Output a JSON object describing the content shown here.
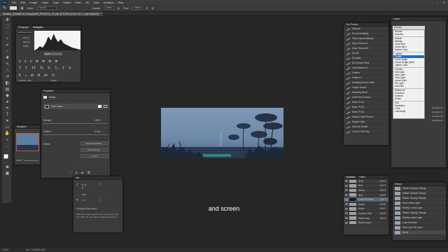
{
  "menubar": {
    "logo": "Ps",
    "items": [
      "File",
      "Edit",
      "Image",
      "Layer",
      "Type",
      "Select",
      "Filter",
      "3D",
      "View",
      "Window",
      "Help"
    ]
  },
  "options": {
    "mode_label": "Mode:",
    "mode_value": "Normal",
    "opacity_label": "Opacity:",
    "opacity_value": "100%",
    "flow_label": "Flow:",
    "flow_value": "100%"
  },
  "document": {
    "tab_title": "Wastika_Z(ineal)ForConceptArt05_PaintOver_01.psb @ 6.49% (Color Fill 4, Layer Mask/8) *"
  },
  "paragraph_panel": {
    "tabs": [
      "Paragraph",
      "Histogram"
    ],
    "font_name": "Gimbose Cont",
    "size": "100 pt",
    "metrics": "Metrics",
    "pct": "100%",
    "language": "English: USA",
    "aa": "Sharp"
  },
  "histogram_color": "Color",
  "properties_panel": {
    "title": "Properties",
    "subtitle": "Masks",
    "layer_mask": "Layer Mask",
    "density_label": "Density:",
    "density_value": "100%",
    "feather_label": "Feather:",
    "feather_value": "0.0 px",
    "refine_label": "Refine:",
    "select_mask_btn": "Select and Mask...",
    "color_range_btn": "Color Range...",
    "invert_btn": "Invert"
  },
  "navigator_panel": {
    "title": "Navigator",
    "zoom": "6.49%"
  },
  "info_panel": {
    "title": "Info",
    "rgb_label": "R: G: B:",
    "bit": "8-bit",
    "xy": "X: Y:",
    "untagged": "Untagged RGB (8bpc)",
    "hint": "Click and drag to paint using foreground color. Use Shift, Alt, and Ctrl for additional options."
  },
  "tool_presets": {
    "title": "Tool Presets",
    "items": [
      "Airbrush",
      "Round Modeling",
      "Paint Canvas Medium",
      "Hairy Texture B",
      "Hairy Texture B2",
      "Dry B1",
      "Dry Bath",
      "Dry Texture Paint",
      "Leaf Abstract 02",
      "Feather",
      "Feather 2",
      "Detailing Round Chalk",
      "Simple Round",
      "Modeling Brush",
      "Soft Pencil Texture",
      "Rake TH 02",
      "Rake TH 03",
      "Rake TH 04",
      "Medium Hard Round",
      "Dragon Hard",
      "Airbrush Rotate",
      "Current Tool Only"
    ]
  },
  "layers_panel": {
    "title": "Layers",
    "blend_selected": "Normal",
    "blend_modes": [
      "Normal",
      "Dissolve",
      "",
      "Darken",
      "Multiply",
      "Color Burn",
      "Linear Burn",
      "Darker Color",
      "",
      "Lighten",
      "Screen",
      "Color Dodge",
      "Linear Dodge (Add)",
      "Lighter Color",
      "",
      "Overlay",
      "Soft Light",
      "Hard Light",
      "Vivid Light",
      "Linear Light",
      "Pin Light",
      "Hard Mix",
      "",
      "Difference",
      "Exclusion",
      "Subtract",
      "Divide",
      "",
      "Hue",
      "Saturation",
      "Color",
      "Luminosity"
    ],
    "highlighted": "Screen",
    "right_labels": [
      "Concept Art",
      "Concept Art",
      "Concept Art",
      "Concept Art"
    ]
  },
  "channels_panel": {
    "tabs": [
      "Channels",
      "Paths"
    ],
    "rows": [
      {
        "name": "RGB",
        "shortcut": "Ctrl+2"
      },
      {
        "name": "Red",
        "shortcut": "Ctrl+3"
      },
      {
        "name": "Green",
        "shortcut": "Ctrl+4"
      },
      {
        "name": "Blue",
        "shortcut": "Ctrl+5"
      },
      {
        "name": "Color Fill 4 Ma...",
        "shortcut": "Ctrl+\\"
      },
      {
        "name": "Depth",
        "shortcut": "Ctrl+6"
      },
      {
        "name": "Depth",
        "shortcut": "Ctrl+7"
      },
      {
        "name": "Camera View",
        "shortcut": "Ctrl+8"
      },
      {
        "name": "Depth copy",
        "shortcut": "Ctrl+9"
      },
      {
        "name": "Depth copy 2",
        "shortcut": ""
      }
    ]
  },
  "history_panel": {
    "title": "History",
    "rows": [
      "Master Opacity Change",
      "Master Opacity Change",
      "Master Opacity Change",
      "New Levels Layer",
      "Modify Levels Layer",
      "Master Opacity Change",
      "Modify Levels Layer",
      "Load Selection",
      "New Color Fill Layer",
      "Brush"
    ]
  },
  "caption": "and screen",
  "statusbar": {
    "zoom": "6.49%",
    "doc": "Doc: 124.8M/1.84G"
  },
  "colors": {
    "accent": "#1e6bc4",
    "canvas_sky": "#6f8aa8",
    "canvas_ground": "#1e2c40"
  }
}
